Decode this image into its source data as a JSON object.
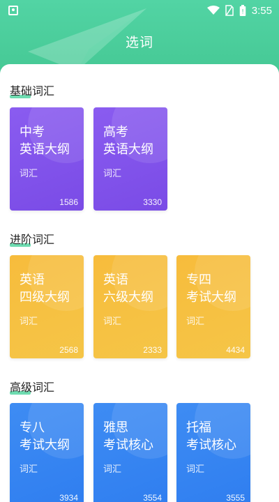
{
  "status_bar": {
    "time": "3:55",
    "icons": [
      "app-notification-icon",
      "wifi-icon",
      "sim-icon",
      "battery-icon"
    ]
  },
  "header": {
    "title": "选词"
  },
  "sections": [
    {
      "title": "基础词汇",
      "cards": [
        {
          "line1": "中考",
          "line2": "英语大纲",
          "tag": "词汇",
          "count": "1586",
          "color": "#8a5cf0"
        },
        {
          "line1": "高考",
          "line2": "英语大纲",
          "tag": "词汇",
          "count": "3330",
          "color": "#8a5cf0"
        }
      ]
    },
    {
      "title": "进阶词汇",
      "cards": [
        {
          "line1": "英语",
          "line2": "四级大纲",
          "tag": "词汇",
          "count": "2568",
          "color": "#f7bc3c"
        },
        {
          "line1": "英语",
          "line2": "六级大纲",
          "tag": "词汇",
          "count": "2333",
          "color": "#f7bc3c"
        },
        {
          "line1": "专四",
          "line2": "考试大纲",
          "tag": "词汇",
          "count": "4434",
          "color": "#f7bc3c"
        }
      ]
    },
    {
      "title": "高级词汇",
      "cards": [
        {
          "line1": "专八",
          "line2": "考试大纲",
          "tag": "词汇",
          "count": "3934",
          "color": "#3e8cf3"
        },
        {
          "line1": "雅思",
          "line2": "考试核心",
          "tag": "词汇",
          "count": "3554",
          "color": "#3e8cf3"
        },
        {
          "line1": "托福",
          "line2": "考试核心",
          "tag": "词汇",
          "count": "3555",
          "color": "#3e8cf3"
        }
      ]
    }
  ]
}
